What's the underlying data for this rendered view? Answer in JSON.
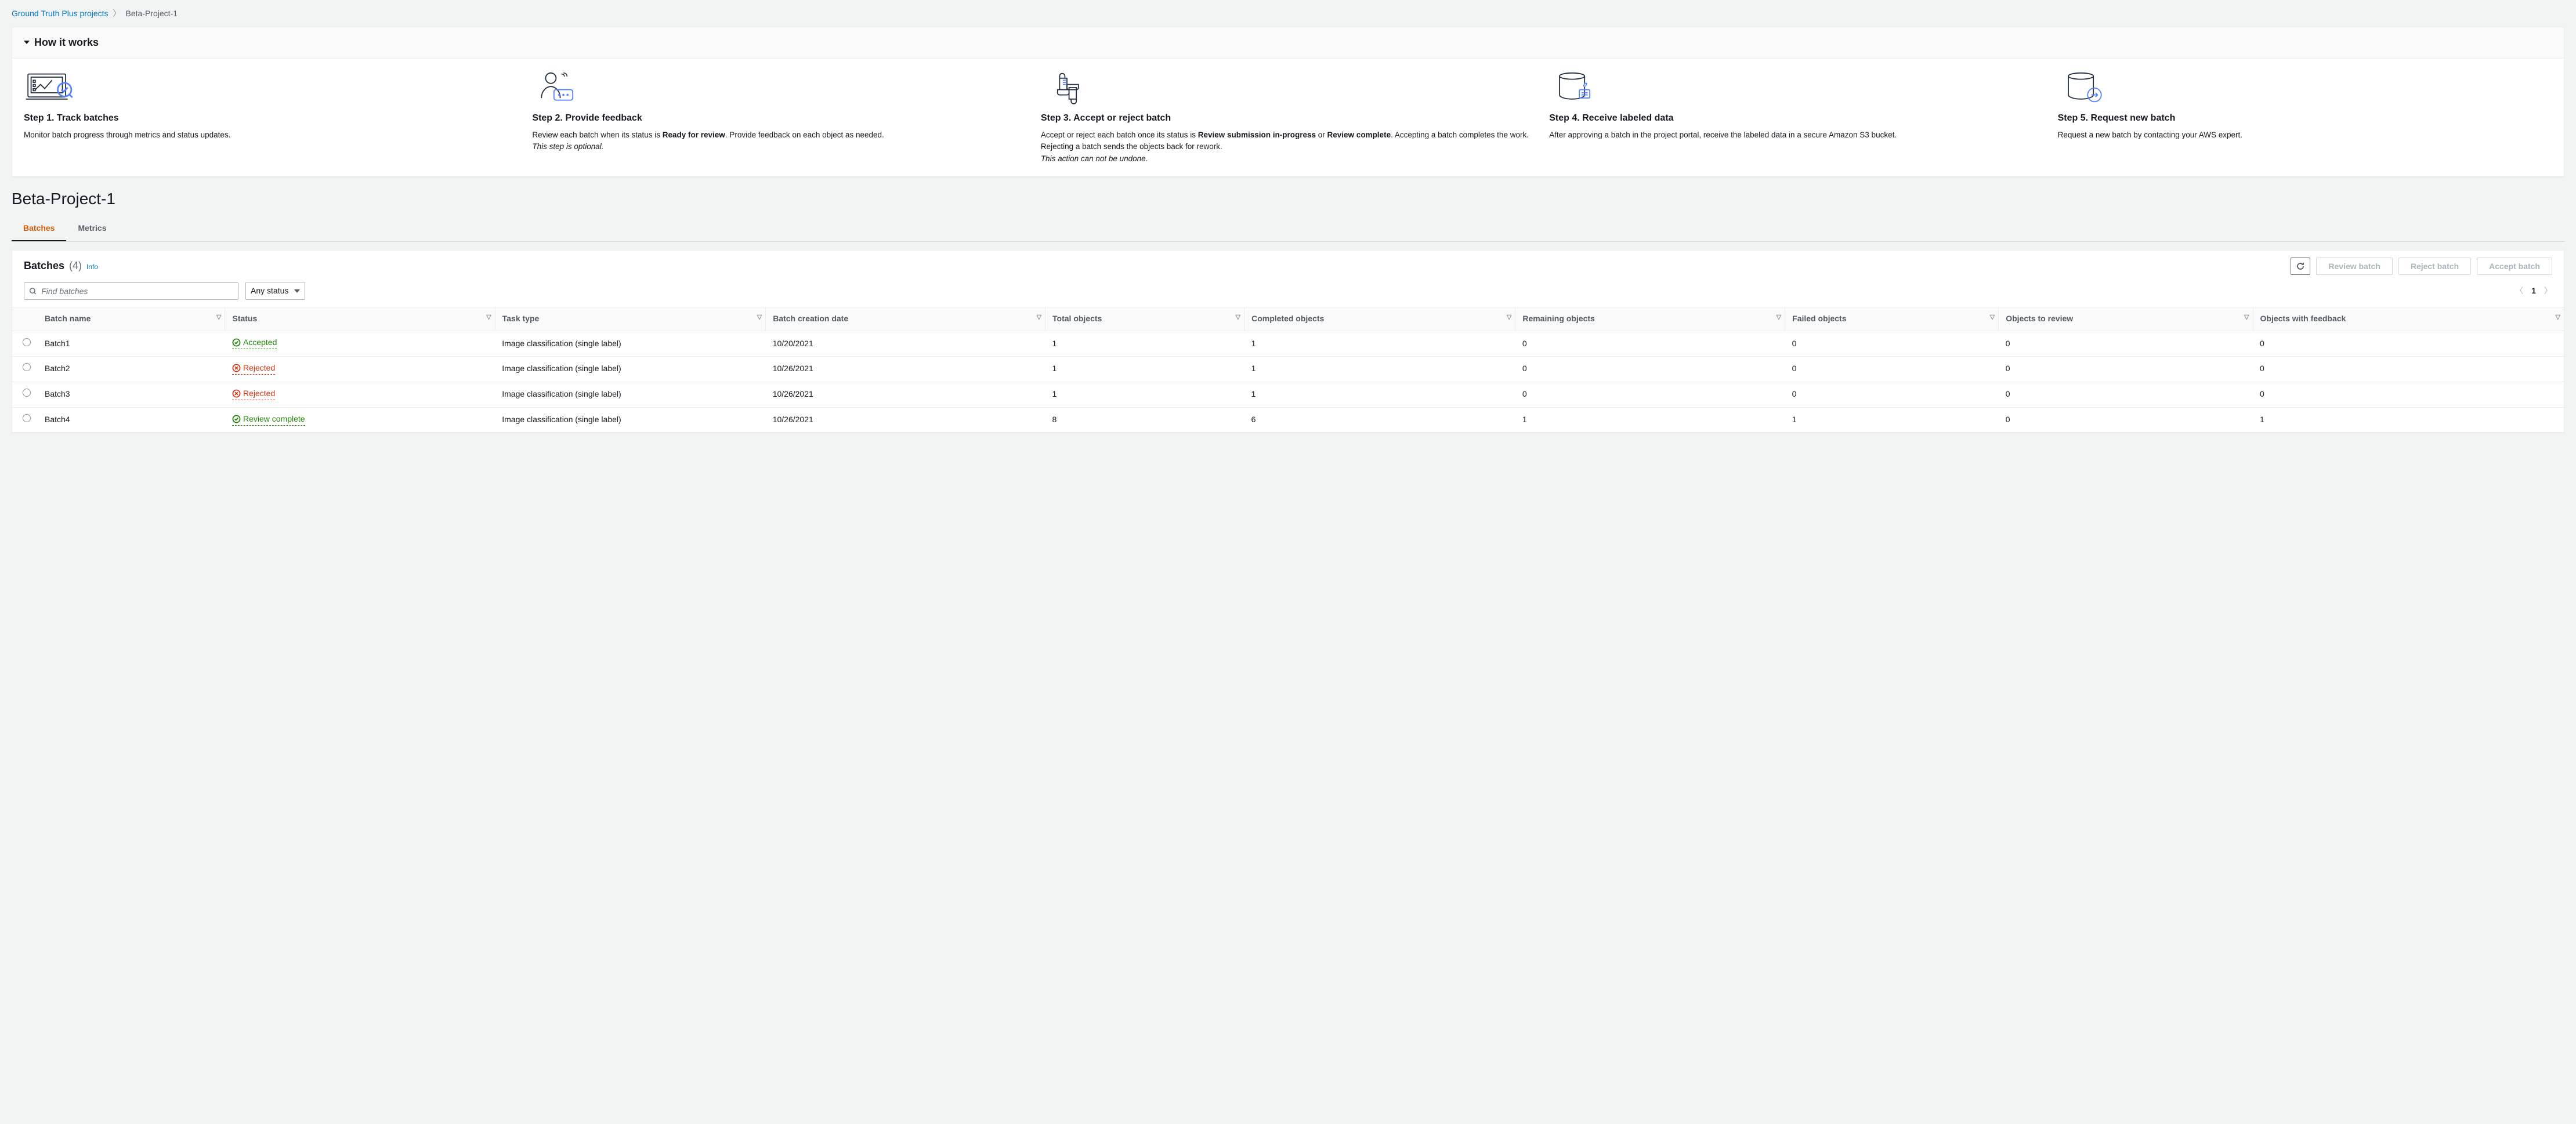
{
  "breadcrumb": {
    "root": "Ground Truth Plus projects",
    "current": "Beta-Project-1"
  },
  "how_it_works": {
    "title": "How it works",
    "steps": [
      {
        "title": "Step 1. Track batches",
        "desc_html": "Monitor batch progress through metrics and status updates."
      },
      {
        "title": "Step 2. Provide feedback",
        "desc_html": "Review each batch when its status is <strong>Ready for review</strong>. Provide feedback on each object as needed.<br><em>This step is optional.</em>"
      },
      {
        "title": "Step 3. Accept or reject batch",
        "desc_html": "Accept or reject each batch once its status is <strong>Review submission in-progress</strong> or <strong>Review complete</strong>. Accepting a batch completes the work. Rejecting a batch sends the objects back for rework.<br><em>This action can not be undone.</em>"
      },
      {
        "title": "Step 4. Receive labeled data",
        "desc_html": "After approving a batch in the project portal, receive the labeled data in a secure Amazon S3 bucket."
      },
      {
        "title": "Step 5. Request new batch",
        "desc_html": "Request a new batch by contacting your AWS expert."
      }
    ]
  },
  "page_title": "Beta-Project-1",
  "tabs": [
    {
      "label": "Batches",
      "active": true
    },
    {
      "label": "Metrics",
      "active": false
    }
  ],
  "batches": {
    "title": "Batches",
    "count": "(4)",
    "info": "Info",
    "actions": {
      "refresh": "Refresh",
      "review": "Review batch",
      "reject": "Reject batch",
      "accept": "Accept batch"
    },
    "search_placeholder": "Find batches",
    "status_filter": "Any status",
    "pagination": {
      "page": "1"
    },
    "columns": [
      "Batch name",
      "Status",
      "Task type",
      "Batch creation date",
      "Total objects",
      "Completed objects",
      "Remaining objects",
      "Failed objects",
      "Objects to review",
      "Objects with feedback"
    ],
    "rows": [
      {
        "name": "Batch1",
        "status": "Accepted",
        "status_kind": "accepted",
        "task_type": "Image classification (single label)",
        "date": "10/20/2021",
        "total": "1",
        "completed": "1",
        "remaining": "0",
        "failed": "0",
        "to_review": "0",
        "feedback": "0"
      },
      {
        "name": "Batch2",
        "status": "Rejected",
        "status_kind": "rejected",
        "task_type": "Image classification (single label)",
        "date": "10/26/2021",
        "total": "1",
        "completed": "1",
        "remaining": "0",
        "failed": "0",
        "to_review": "0",
        "feedback": "0"
      },
      {
        "name": "Batch3",
        "status": "Rejected",
        "status_kind": "rejected",
        "task_type": "Image classification (single label)",
        "date": "10/26/2021",
        "total": "1",
        "completed": "1",
        "remaining": "0",
        "failed": "0",
        "to_review": "0",
        "feedback": "0"
      },
      {
        "name": "Batch4",
        "status": "Review complete",
        "status_kind": "accepted",
        "task_type": "Image classification (single label)",
        "date": "10/26/2021",
        "total": "8",
        "completed": "6",
        "remaining": "1",
        "failed": "1",
        "to_review": "0",
        "feedback": "1"
      }
    ]
  }
}
